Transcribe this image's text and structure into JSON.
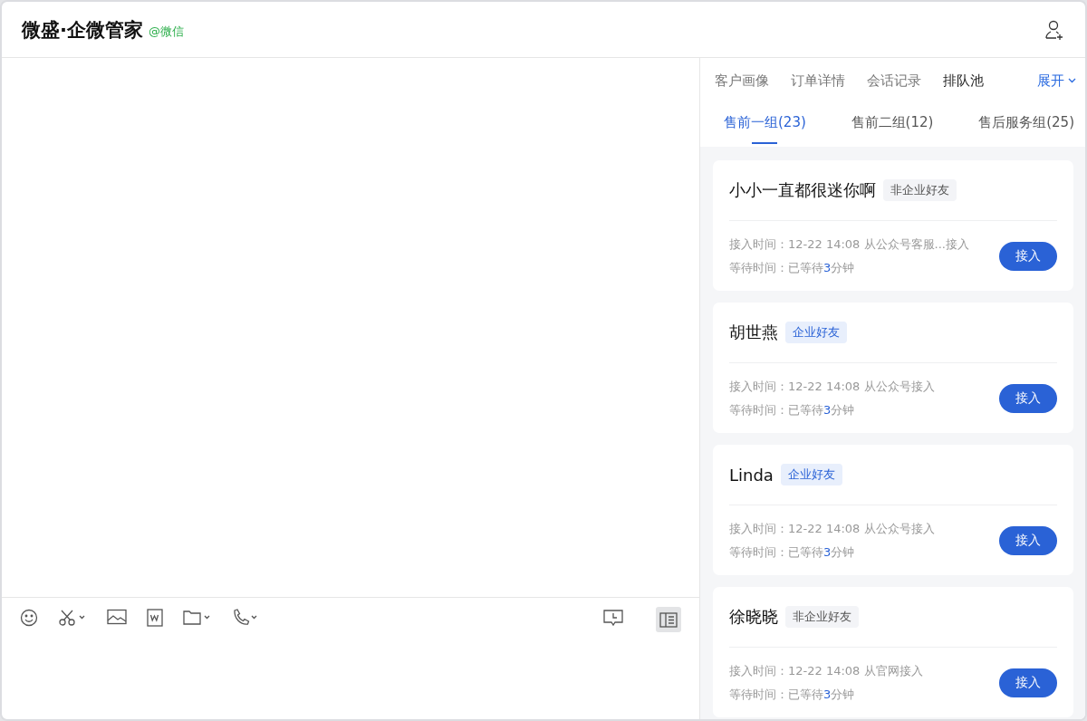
{
  "header": {
    "title": "微盛·企微管家",
    "source": "@微信"
  },
  "top_tabs": [
    {
      "label": "客户画像",
      "selected": false
    },
    {
      "label": "订单详情",
      "selected": false
    },
    {
      "label": "会话记录",
      "selected": false
    },
    {
      "label": "排队池",
      "selected": true
    }
  ],
  "expand_link": "展开",
  "group_tabs": [
    {
      "label": "售前一组(23)",
      "selected": true
    },
    {
      "label": "售前二组(12)",
      "selected": false
    },
    {
      "label": "售后服务组(25)",
      "selected": false
    }
  ],
  "sidebar_toggle": {
    "on": true
  },
  "queue": [
    {
      "name": "小小一直都很迷你啊",
      "tag": {
        "kind": "non_enterprise",
        "label": "非企业好友"
      },
      "access_label": "接入时间：",
      "access_value": "12-22 14:08 从公众号客服...接入",
      "wait_label": "等待时间：",
      "wait_prefix": "已等待",
      "wait_minutes": "3",
      "wait_suffix": "分钟",
      "button": "接入"
    },
    {
      "name": "胡世燕",
      "tag": {
        "kind": "enterprise",
        "label": "企业好友"
      },
      "access_label": "接入时间：",
      "access_value": "12-22 14:08 从公众号接入",
      "wait_label": "等待时间：",
      "wait_prefix": "已等待",
      "wait_minutes": "3",
      "wait_suffix": "分钟",
      "button": "接入"
    },
    {
      "name": "Linda",
      "tag": {
        "kind": "enterprise",
        "label": "企业好友"
      },
      "access_label": "接入时间：",
      "access_value": "12-22 14:08 从公众号接入",
      "wait_label": "等待时间：",
      "wait_prefix": "已等待",
      "wait_minutes": "3",
      "wait_suffix": "分钟",
      "button": "接入"
    },
    {
      "name": "徐晓晓",
      "tag": {
        "kind": "non_enterprise",
        "label": "非企业好友"
      },
      "access_label": "接入时间：",
      "access_value": "12-22 14:08 从官网接入",
      "wait_label": "等待时间：",
      "wait_prefix": "已等待",
      "wait_minutes": "3",
      "wait_suffix": "分钟",
      "button": "接入"
    }
  ]
}
